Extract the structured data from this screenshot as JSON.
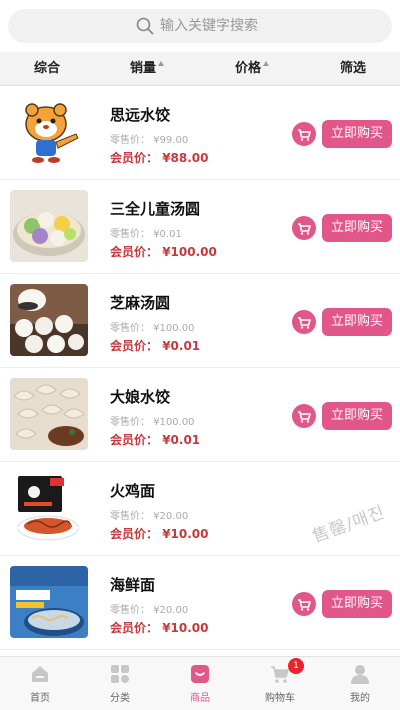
{
  "search": {
    "placeholder": "输入关键字搜索"
  },
  "sort": {
    "items": [
      {
        "label": "综合"
      },
      {
        "label": "销量"
      },
      {
        "label": "价格"
      },
      {
        "label": "筛选"
      }
    ]
  },
  "retail_prefix": "零售价：",
  "member_prefix": "会员价：",
  "buy_label": "立即购买",
  "products": [
    {
      "name": "思远水饺",
      "retail": "¥99.00",
      "member": "¥88.00"
    },
    {
      "name": "三全儿童汤圆",
      "retail": "¥0.01",
      "member": "¥100.00"
    },
    {
      "name": "芝麻汤圆",
      "retail": "¥100.00",
      "member": "¥0.01"
    },
    {
      "name": "大娘水饺",
      "retail": "¥100.00",
      "member": "¥0.01"
    },
    {
      "name": "火鸡面",
      "retail": "¥20.00",
      "member": "¥10.00",
      "soldout": "售罄/매진"
    },
    {
      "name": "海鲜面",
      "retail": "¥20.00",
      "member": "¥10.00"
    }
  ],
  "tabbar": {
    "items": [
      {
        "label": "首页",
        "icon": "home-icon"
      },
      {
        "label": "分类",
        "icon": "category-icon"
      },
      {
        "label": "商品",
        "icon": "goods-bag-icon"
      },
      {
        "label": "购物车",
        "icon": "cart-icon",
        "badge": "1"
      },
      {
        "label": "我的",
        "icon": "profile-icon"
      }
    ],
    "active": "商品"
  },
  "colors": {
    "accent": "#e2578a",
    "price": "#c8383c",
    "badge": "#e8252b"
  }
}
